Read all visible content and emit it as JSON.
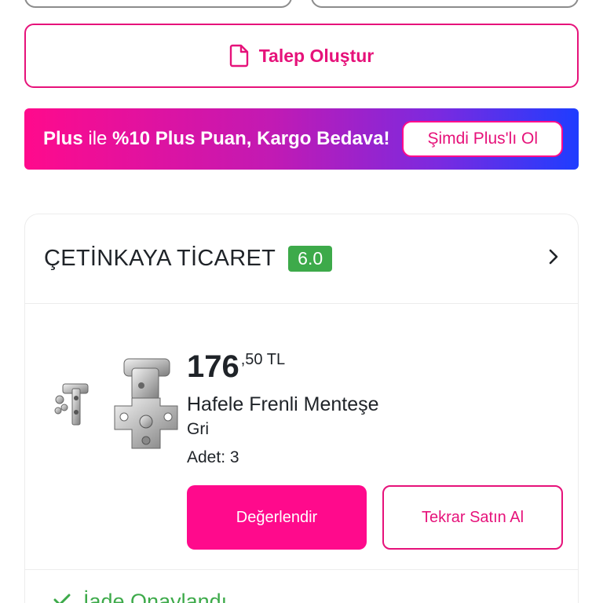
{
  "talep": {
    "label": "Talep Oluştur",
    "icon": "document-icon",
    "color": "#e6127a"
  },
  "plus_banner": {
    "brand": "Plus",
    "text_mid": " ile ",
    "text_bold": "%10 Plus Puan, Kargo Bedava!",
    "cta_label": "Şimdi Plus'lı Ol",
    "gradient": [
      "#ff0a8c",
      "#c11ab4",
      "#7a2ae0",
      "#1e3dff"
    ]
  },
  "seller": {
    "name": "ÇETİNKAYA TİCARET",
    "rating": "6.0",
    "rating_color": "#3daa4a",
    "chevron_icon": "chevron-right-icon"
  },
  "product": {
    "image_icon": "hinge-image",
    "price_int": "176",
    "price_dec": ",50 TL",
    "name": "Hafele Frenli Menteşe",
    "color": "Gri",
    "quantity": "Adet: 3"
  },
  "actions": {
    "rate_label": "Değerlendir",
    "rebuy_label": "Tekrar Satın Al",
    "accent": "#ff0a8c"
  },
  "status": {
    "text": "İade Onaylandı",
    "icon": "checkmark-icon",
    "color": "#3daa4a"
  }
}
